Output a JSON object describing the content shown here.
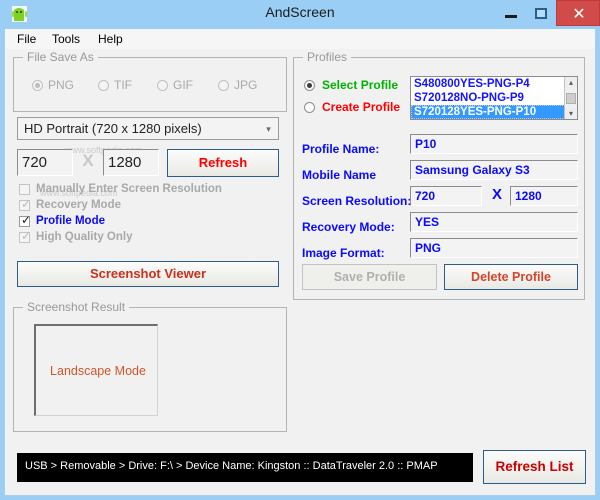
{
  "window": {
    "title": "AndScreen",
    "icon": "android-robot-icon",
    "controls": {
      "minimize": "–",
      "maximize": "□",
      "close": "✕"
    }
  },
  "menu": {
    "items": [
      {
        "label": "File"
      },
      {
        "label": "Tools"
      },
      {
        "label": "Help"
      }
    ]
  },
  "file_save_as": {
    "title": "File Save As",
    "enabled": false,
    "options": [
      {
        "label": "PNG",
        "selected": true
      },
      {
        "label": "TIF",
        "selected": false
      },
      {
        "label": "GIF",
        "selected": false
      },
      {
        "label": "JPG",
        "selected": false
      }
    ]
  },
  "resolution_preset": {
    "selected": "HD Portrait (720 x 1280 pixels)",
    "arrow": "▾"
  },
  "resolution": {
    "width": "720",
    "separator": "X",
    "height": "1280"
  },
  "refresh_button": {
    "label": "Refresh"
  },
  "checkboxes": [
    {
      "label": "Manually Enter Screen Resolution",
      "checked": false,
      "enabled": false,
      "color": "#a9a9a9"
    },
    {
      "label": "Recovery Mode",
      "checked": true,
      "enabled": false,
      "color": "#a9a9a9"
    },
    {
      "label": "Profile Mode",
      "checked": true,
      "enabled": true,
      "color": "#0a0aff"
    },
    {
      "label": "High Quality Only",
      "checked": true,
      "enabled": false,
      "color": "#a9a9a9"
    }
  ],
  "screenshot_viewer_button": {
    "label": "Screenshot Viewer"
  },
  "profiles": {
    "title": "Profiles",
    "modes": [
      {
        "label": "Select Profile",
        "selected": true,
        "color": "#00b300"
      },
      {
        "label": "Create Profile",
        "selected": false,
        "color": "#ff0000"
      }
    ],
    "list": [
      {
        "label": "S480800YES-PNG-P4",
        "selected": false
      },
      {
        "label": "S720128NO-PNG-P9",
        "selected": false
      },
      {
        "label": "S720128YES-PNG-P10",
        "selected": true
      }
    ],
    "scrollbar": {
      "up_arrow": "▴",
      "down_arrow": "▾"
    },
    "fields": {
      "profile_name_label": "Profile Name:",
      "profile_name_value": "P10",
      "mobile_name_label": "Mobile Name",
      "mobile_name_value": "Samsung Galaxy S3",
      "screen_resolution_label": "Screen Resolution:",
      "screen_resolution_width": "720",
      "screen_resolution_separator": "X",
      "screen_resolution_height": "1280",
      "recovery_mode_label": "Recovery Mode:",
      "recovery_mode_value": "YES",
      "image_format_label": "Image Format:",
      "image_format_value": "PNG"
    },
    "save_button": {
      "label": "Save Profile",
      "enabled": false
    },
    "delete_button": {
      "label": "Delete Profile",
      "enabled": true
    }
  },
  "screenshot_result": {
    "title": "Screenshot Result",
    "preview_label": "Landscape Mode"
  },
  "status": {
    "text": "USB > Removable >  Drive: F:\\ >  Device Name: Kingston :: DataTraveler 2.0 :: PMAP"
  },
  "refresh_list_button": {
    "label": "Refresh List"
  },
  "colors": {
    "title_bar": "#9ACEF5",
    "close_button": "#d14b4b",
    "client_background": "#f1f1f1",
    "accent_red": "#ff0000",
    "accent_blue": "#0a0aff",
    "accent_green": "#00b300",
    "selection_blue": "#3399ff",
    "status_bar": "#000000"
  }
}
